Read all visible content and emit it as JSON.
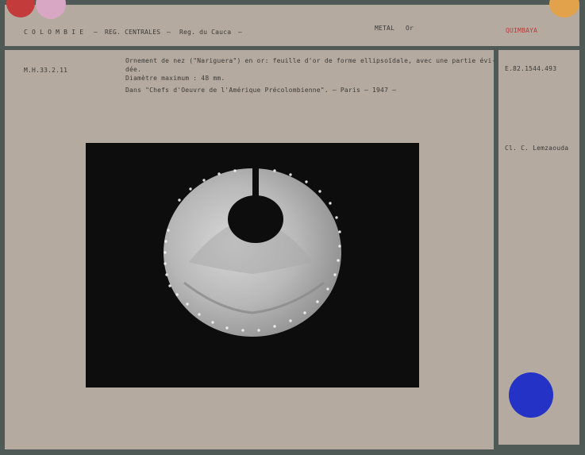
{
  "header": {
    "country": "C O L O M B I E",
    "sep1": "–",
    "region": "REG. CENTRALES",
    "sep2": "–",
    "locality": "Reg. du Cauca",
    "sep3": "–",
    "material": "METAL",
    "material_value": "Or",
    "culture": "QUIMBAYA"
  },
  "record": {
    "inventory_left": "M.H.33.2.11",
    "description_line1": "Ornement de nez (\"Nariguera\") en or: feuille d'or de forme ellipsoïdale, avec une partie évi-",
    "description_line2": "dée.",
    "diameter": "Diamètre maximum : 48 mm.",
    "publication": "Dans  \"Chefs d'Oeuvre de l'Amérique Précolombienne\".   – Paris – 1947 –",
    "inventory_right": "E.82.1544.493",
    "photo_credit": "Cl. C. Lemzaouda"
  },
  "colors": {
    "card": "#b4aa9f",
    "background": "#4f5a57",
    "dot_red": "#c43b3b",
    "dot_pink": "#d7a7c3",
    "dot_orange": "#e1a24b",
    "dot_blue": "#2432c6",
    "photo_bg": "#0d0d0d"
  }
}
